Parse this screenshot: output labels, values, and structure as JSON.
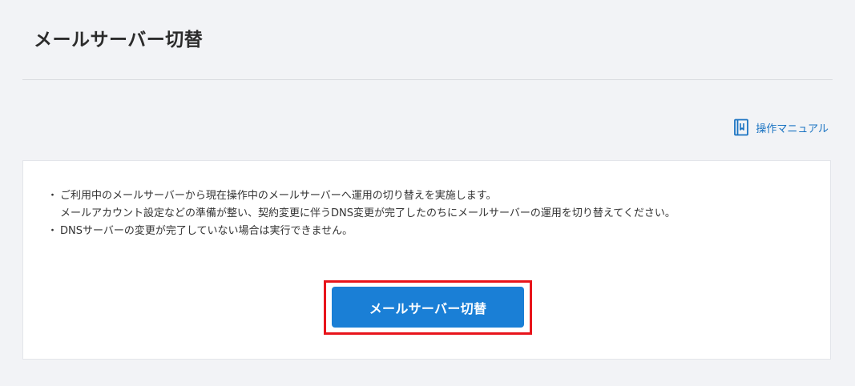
{
  "header": {
    "title": "メールサーバー切替"
  },
  "toolbar": {
    "manual_link_label": "操作マニュアル",
    "manual_icon": "manual-book-icon",
    "link_color": "#1a73c2"
  },
  "card": {
    "notes": [
      {
        "lines": [
          "ご利用中のメールサーバーから現在操作中のメールサーバーへ運用の切り替えを実施します。",
          "メールアカウント設定などの準備が整い、契約変更に伴うDNS変更が完了したのちにメールサーバーの運用を切り替えてください。"
        ]
      },
      {
        "lines": [
          "DNSサーバーの変更が完了していない場合は実行できません。"
        ]
      }
    ],
    "primary_button_label": "メールサーバー切替",
    "primary_button_color": "#1a7fd6",
    "highlight_color": "#e8141b"
  }
}
